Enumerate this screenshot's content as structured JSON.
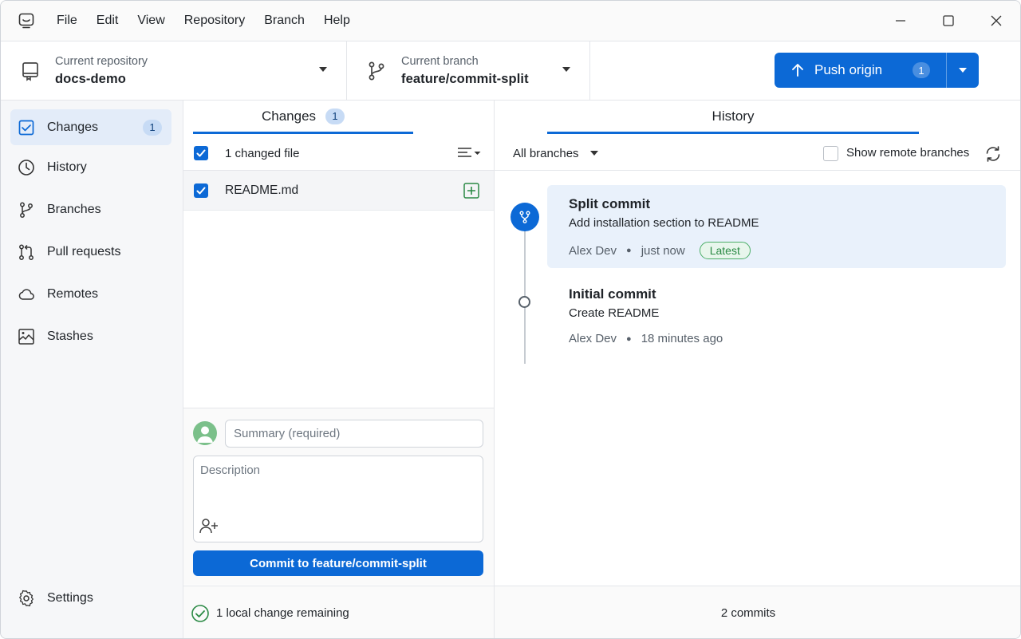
{
  "menu": {
    "items": [
      {
        "label": "File"
      },
      {
        "label": "Edit"
      },
      {
        "label": "View"
      },
      {
        "label": "Repository"
      },
      {
        "label": "Branch"
      },
      {
        "label": "Help"
      }
    ]
  },
  "toolbar": {
    "repo": {
      "sub_label": "Current repository",
      "value": "docs-demo"
    },
    "branch": {
      "sub_label": "Current branch",
      "value": "feature/commit-split"
    },
    "push": {
      "label": "Push origin",
      "count": "1"
    }
  },
  "sidebar": {
    "items": [
      {
        "label": "Changes",
        "badge": "1",
        "icon": "changes-icon",
        "active": true
      },
      {
        "label": "History",
        "icon": "history-icon"
      },
      {
        "label": "Branches",
        "icon": "branch-icon"
      },
      {
        "label": "Pull requests",
        "icon": "pull-request-icon"
      },
      {
        "label": "Remotes",
        "icon": "cloud-icon"
      },
      {
        "label": "Stashes",
        "icon": "stash-icon"
      }
    ],
    "settings": {
      "label": "Settings",
      "icon": "gear-icon"
    }
  },
  "changes": {
    "tab_label": "Changes",
    "tab_badge": "1",
    "changed_files_label": "1 changed file",
    "files": [
      {
        "name": "README.md",
        "status": "added"
      }
    ],
    "summary_placeholder": "Summary (required)",
    "description_placeholder": "Description",
    "commit_button": "Commit to feature/commit-split",
    "local_change": "1 local change remaining"
  },
  "history": {
    "tab_label": "History",
    "branch_filter": "All branches",
    "remote_toggle_label": "Show remote branches",
    "commits": [
      {
        "title": "Split commit",
        "subtitle": "Add installation section to README",
        "author": "Alex Dev",
        "time": "just now",
        "badge": "Latest"
      },
      {
        "title": "Initial commit",
        "subtitle": "Create README",
        "author": "Alex Dev",
        "time": "18 minutes ago"
      }
    ],
    "footer": "2 commits"
  },
  "colors": {
    "accent": "#0c69d6",
    "active_bg": "#e3ecf9",
    "latest_green": "#2b8a45"
  }
}
